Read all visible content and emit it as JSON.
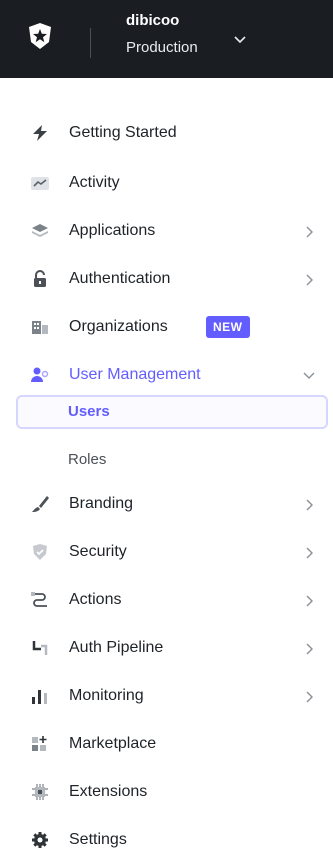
{
  "tenant": {
    "name": "dibicoo",
    "environment": "Production"
  },
  "nav": {
    "getting_started": "Getting Started",
    "activity": "Activity",
    "applications": "Applications",
    "authentication": "Authentication",
    "organizations": "Organizations",
    "organizations_badge": "NEW",
    "user_management": "User Management",
    "users": "Users",
    "roles": "Roles",
    "branding": "Branding",
    "security": "Security",
    "actions": "Actions",
    "auth_pipeline": "Auth Pipeline",
    "monitoring": "Monitoring",
    "marketplace": "Marketplace",
    "extensions": "Extensions",
    "settings": "Settings"
  },
  "colors": {
    "topbar_bg": "#1a1d22",
    "accent": "#635dff",
    "selected_border": "#d7d6ff"
  }
}
